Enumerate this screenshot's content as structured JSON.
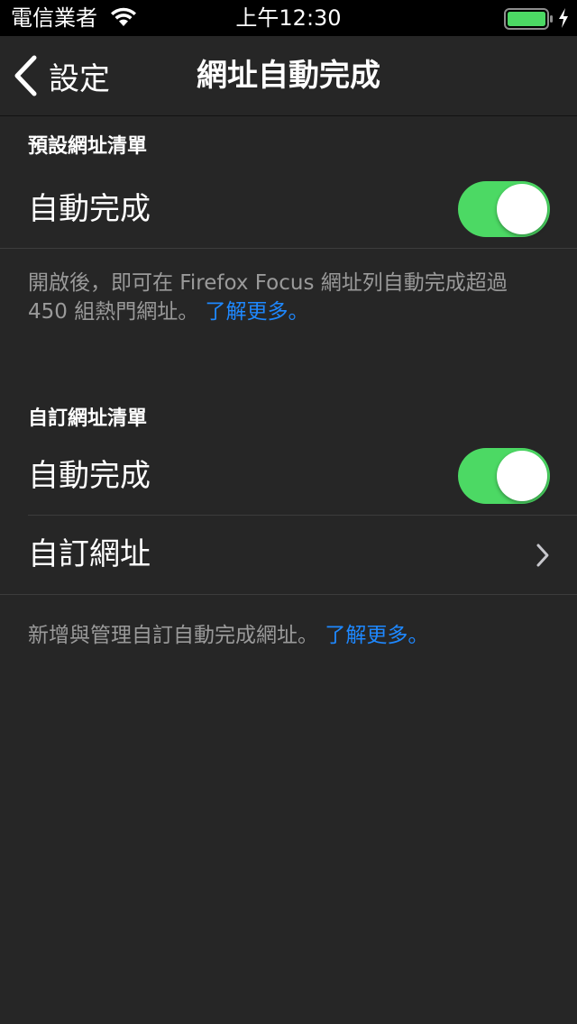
{
  "status_bar": {
    "carrier": "電信業者",
    "time": "上午12:30",
    "battery_color": "#4cd964"
  },
  "nav": {
    "back_label": "設定",
    "title": "網址自動完成"
  },
  "sections": [
    {
      "header": "預設網址清單",
      "rows": [
        {
          "label": "自動完成",
          "toggle_on": true
        }
      ],
      "footer": "開啟後，即可在 Firefox Focus 網址列自動完成超過 450 組熱門網址。",
      "footer_link": "了解更多。"
    },
    {
      "header": "自訂網址清單",
      "rows": [
        {
          "label": "自動完成",
          "toggle_on": true
        },
        {
          "label": "自訂網址",
          "accessory": "chevron-right-icon"
        }
      ],
      "footer": "新增與管理自訂自動完成網址。",
      "footer_link": "了解更多。"
    }
  ],
  "colors": {
    "background": "#262626",
    "toggle_on": "#4cd964",
    "link": "#1e88ff",
    "footer_text": "#9a9a9a"
  }
}
